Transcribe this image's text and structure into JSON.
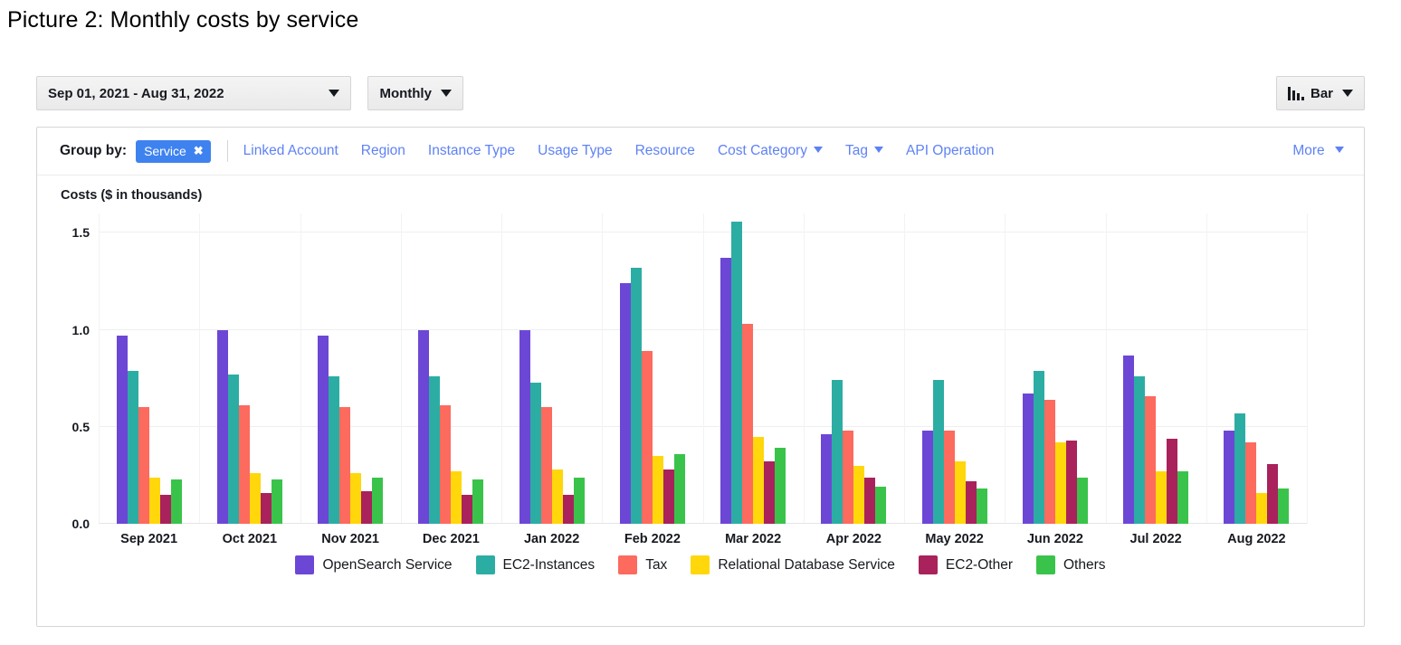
{
  "caption": "Picture 2: Monthly costs by service",
  "toolbar": {
    "date_range": "Sep 01, 2021 - Aug 31, 2022",
    "granularity": "Monthly",
    "chart_type": "Bar",
    "chart_type_icon": "bar-chart-icon"
  },
  "group_by": {
    "label": "Group by:",
    "selected_chip": "Service",
    "chip_remove_icon": "✖",
    "options": [
      {
        "label": "Linked Account",
        "has_caret": false
      },
      {
        "label": "Region",
        "has_caret": false
      },
      {
        "label": "Instance Type",
        "has_caret": false
      },
      {
        "label": "Usage Type",
        "has_caret": false
      },
      {
        "label": "Resource",
        "has_caret": false
      },
      {
        "label": "Cost Category",
        "has_caret": true
      },
      {
        "label": "Tag",
        "has_caret": true
      },
      {
        "label": "API Operation",
        "has_caret": false
      }
    ],
    "more_label": "More",
    "accent_color": "#3e82f0",
    "link_color": "#5e82f4"
  },
  "chart_data": {
    "type": "bar",
    "title": "",
    "ylabel": "Costs ($ in thousands)",
    "xlabel": "",
    "ylim": [
      0.0,
      1.6
    ],
    "yticks": [
      0.0,
      0.5,
      1.0,
      1.5
    ],
    "ytick_labels": [
      "0.0",
      "0.5",
      "1.0",
      "1.5"
    ],
    "grid": true,
    "legend_position": "bottom",
    "categories": [
      "Sep 2021",
      "Oct 2021",
      "Nov 2021",
      "Dec 2021",
      "Jan 2022",
      "Feb 2022",
      "Mar 2022",
      "Apr 2022",
      "May 2022",
      "Jun 2022",
      "Jul 2022",
      "Aug 2022"
    ],
    "series": [
      {
        "name": "OpenSearch Service",
        "color": "#6c47d6",
        "values": [
          0.97,
          1.0,
          0.97,
          1.0,
          1.0,
          1.24,
          1.37,
          0.46,
          0.48,
          0.67,
          0.87,
          0.48
        ]
      },
      {
        "name": "EC2-Instances",
        "color": "#2cada4",
        "values": [
          0.79,
          0.77,
          0.76,
          0.76,
          0.73,
          1.32,
          1.56,
          0.74,
          0.74,
          0.79,
          0.76,
          0.57
        ]
      },
      {
        "name": "Tax",
        "color": "#fd6a5e",
        "values": [
          0.6,
          0.61,
          0.6,
          0.61,
          0.6,
          0.89,
          1.03,
          0.48,
          0.48,
          0.64,
          0.66,
          0.42
        ]
      },
      {
        "name": "Relational Database Service",
        "color": "#ffd70a",
        "values": [
          0.24,
          0.26,
          0.26,
          0.27,
          0.28,
          0.35,
          0.45,
          0.3,
          0.32,
          0.42,
          0.27,
          0.16
        ]
      },
      {
        "name": "EC2-Other",
        "color": "#a9225c",
        "values": [
          0.15,
          0.16,
          0.17,
          0.15,
          0.15,
          0.28,
          0.32,
          0.24,
          0.22,
          0.43,
          0.44,
          0.31
        ]
      },
      {
        "name": "Others",
        "color": "#3ac34a",
        "values": [
          0.23,
          0.23,
          0.24,
          0.23,
          0.24,
          0.36,
          0.39,
          0.19,
          0.18,
          0.24,
          0.27,
          0.18
        ]
      }
    ]
  }
}
